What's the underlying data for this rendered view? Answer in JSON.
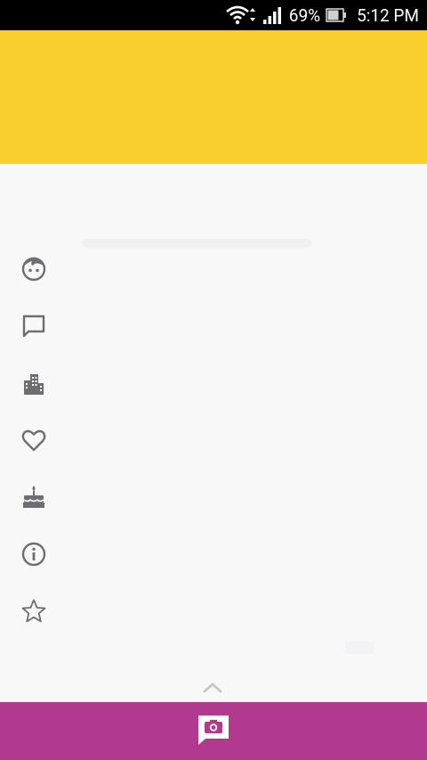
{
  "status_bar": {
    "battery_percent": "69%",
    "time": "5:12 PM",
    "icons": [
      "wifi-icon",
      "signal-icon",
      "battery-icon"
    ]
  },
  "header": {
    "color": "#f9cf2e"
  },
  "profile_icons": [
    "face-icon",
    "chat-bubble-icon",
    "city-icon",
    "heart-icon",
    "cake-icon",
    "info-icon",
    "star-icon"
  ],
  "bottom_bar": {
    "color": "#b13a8f",
    "action_icon": "add-photo-icon",
    "expand_icon": "chevron-up-icon"
  }
}
